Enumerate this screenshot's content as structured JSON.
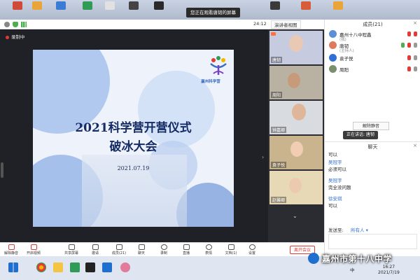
{
  "overlay": {
    "screen_share_hint": "您正在观看唐韧的屏幕"
  },
  "toolbar_top": {
    "timer": "24:12",
    "view_mode": "演讲者视图"
  },
  "stage": {
    "recording_label": "录制中",
    "slide": {
      "title_line1": "2021科学营开营仪式",
      "title_line2": "破冰大会",
      "date": "2021.07.19",
      "logo_text": "赢州科学营"
    }
  },
  "video_tiles": [
    {
      "name": "唐韧"
    },
    {
      "name": "周阳"
    },
    {
      "name": "钟嘉卿"
    },
    {
      "name": "袁子悦"
    },
    {
      "name": "赵馨卿"
    }
  ],
  "bottom_toolbar": {
    "items": [
      "解除静音",
      "开启视频",
      "共享屏幕",
      "邀请",
      "成员(21)",
      "聊天",
      "录制",
      "直播",
      "表情",
      "文档(1)",
      "设置"
    ],
    "leave": "离开会议"
  },
  "members": {
    "title": "成员(21)",
    "list": [
      {
        "name": "嘉州十八中程鑫",
        "role": "(我)",
        "avatar_color": "#5c8fd6"
      },
      {
        "name": "唐韧",
        "role": "(主持人)",
        "avatar_color": "#e07a5f"
      },
      {
        "name": "袁子悦",
        "role": "",
        "avatar_color": "#2f6fd6"
      },
      {
        "name": "周阳",
        "role": "",
        "avatar_color": "#7a8f6a"
      }
    ],
    "unmute_all": "解除静音",
    "speaking": "正在讲话: 唐韧"
  },
  "chat": {
    "title": "聊天",
    "messages": [
      {
        "sender": "",
        "text": "可以"
      },
      {
        "sender": "吴冠宇",
        "text": "必须可以"
      },
      {
        "sender": "吴冠宇",
        "text": "完全没问题"
      },
      {
        "sender": "徐安琪",
        "text": "可以"
      }
    ],
    "send_to_label": "发送至:",
    "send_to_value": "所有人"
  },
  "taskbar": {
    "lang": "中",
    "time": "16:27",
    "date": "2021/7/19"
  },
  "watermark": "嘉州市第十八中学",
  "colors": {
    "accent": "#2f6fd6",
    "danger": "#e53935",
    "slide_title": "#152b66"
  }
}
